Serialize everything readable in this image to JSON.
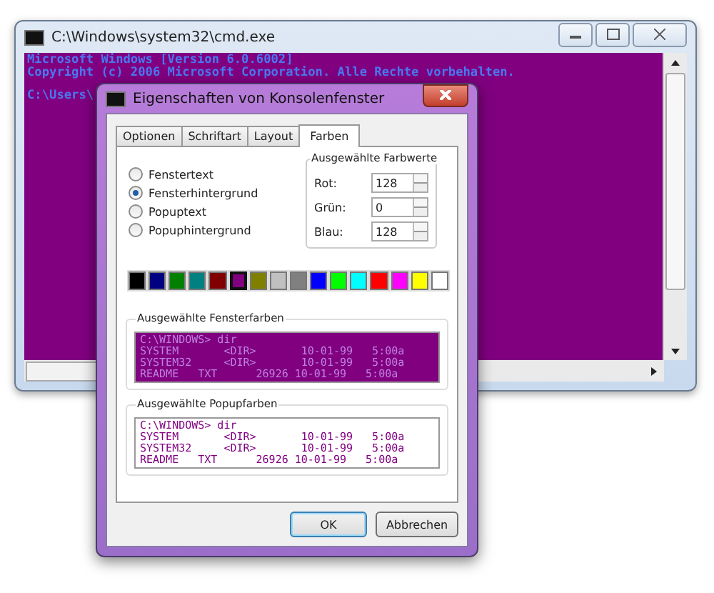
{
  "console_window": {
    "title": "C:\\Windows\\system32\\cmd.exe",
    "lines": [
      "Microsoft Windows [Version 6.0.6002]",
      "Copyright (c) 2006 Microsoft Corporation. Alle Rechte vorbehalten.",
      "C:\\Users\\"
    ]
  },
  "dialog": {
    "title": "Eigenschaften von Konsolenfenster",
    "tabs": [
      {
        "label": "Optionen",
        "selected": false
      },
      {
        "label": "Schriftart",
        "selected": false
      },
      {
        "label": "Layout",
        "selected": false
      },
      {
        "label": "Farben",
        "selected": true
      }
    ],
    "targets": [
      {
        "label": "Fenstertext",
        "selected": false
      },
      {
        "label": "Fensterhintergrund",
        "selected": true
      },
      {
        "label": "Popuptext",
        "selected": false
      },
      {
        "label": "Popuphintergrund",
        "selected": false
      }
    ],
    "color_values": {
      "title": "Ausgewählte Farbwerte",
      "fields": [
        {
          "label": "Rot:",
          "value": "128"
        },
        {
          "label": "Grün:",
          "value": "0"
        },
        {
          "label": "Blau:",
          "value": "128"
        }
      ]
    },
    "swatches": [
      {
        "color": "#000000",
        "selected": false
      },
      {
        "color": "#000080",
        "selected": false
      },
      {
        "color": "#008000",
        "selected": false
      },
      {
        "color": "#008080",
        "selected": false
      },
      {
        "color": "#800000",
        "selected": false
      },
      {
        "color": "#800080",
        "selected": true
      },
      {
        "color": "#808000",
        "selected": false
      },
      {
        "color": "#c0c0c0",
        "selected": false
      },
      {
        "color": "#808080",
        "selected": false
      },
      {
        "color": "#0000ff",
        "selected": false
      },
      {
        "color": "#00ff00",
        "selected": false
      },
      {
        "color": "#00ffff",
        "selected": false
      },
      {
        "color": "#ff0000",
        "selected": false
      },
      {
        "color": "#ff00ff",
        "selected": false
      },
      {
        "color": "#ffff00",
        "selected": false
      },
      {
        "color": "#ffffff",
        "selected": false
      }
    ],
    "previews": [
      {
        "kind": "window",
        "title": "Ausgewählte Fensterfarben",
        "lines": [
          "C:\\WINDOWS> dir",
          "SYSTEM       <DIR>       10-01-99   5:00a",
          "SYSTEM32     <DIR>       10-01-99   5:00a",
          "README   TXT      26926 10-01-99   5:00a"
        ]
      },
      {
        "kind": "popup",
        "title": "Ausgewählte Popupfarben",
        "lines": [
          "C:\\WINDOWS> dir",
          "SYSTEM       <DIR>       10-01-99   5:00a",
          "SYSTEM32     <DIR>       10-01-99   5:00a",
          "README   TXT      26926 10-01-99   5:00a"
        ]
      }
    ],
    "buttons": [
      "OK",
      "Abbrechen"
    ]
  }
}
